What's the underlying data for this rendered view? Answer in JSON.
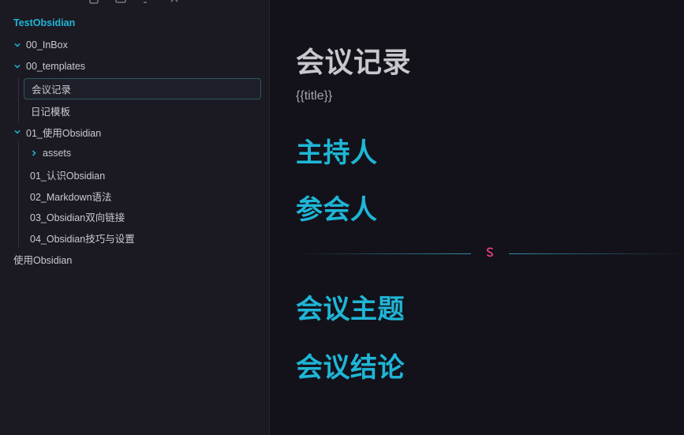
{
  "sidebar": {
    "toolbar_icons": [
      "new-note-icon",
      "new-folder-icon",
      "sort-icon",
      "collapse-icon"
    ],
    "vault_name": "TestObsidian",
    "tree": [
      {
        "label": "00_InBox",
        "type": "folder",
        "expanded": true
      },
      {
        "label": "00_templates",
        "type": "folder",
        "expanded": true
      },
      {
        "label": "会议记录",
        "type": "file",
        "active": true
      },
      {
        "label": "日记模板",
        "type": "file"
      },
      {
        "label": "01_使用Obsidian",
        "type": "folder",
        "expanded": true
      },
      {
        "label": "assets",
        "type": "folder",
        "expanded": false
      },
      {
        "label": "01_认识Obsidian",
        "type": "file"
      },
      {
        "label": "02_Markdown语法",
        "type": "file"
      },
      {
        "label": "03_Obsidian双向链接",
        "type": "file"
      },
      {
        "label": "04_Obsidian技巧与设置",
        "type": "file"
      },
      {
        "label": "使用Obsidian",
        "type": "file"
      }
    ]
  },
  "editor": {
    "h1": "会议记录",
    "body_text": "{{title}}",
    "sections": [
      {
        "label": "主持人"
      },
      {
        "label": "参会人"
      },
      {
        "label": "会议主题"
      },
      {
        "label": "会议结论"
      }
    ],
    "divider_icon": "section-divider-icon"
  },
  "colors": {
    "accent": "#1fb6d6",
    "sidebar_bg": "#1b1a23",
    "editor_bg": "#13121a",
    "text": "#c9c9cf",
    "divider_glyph": "#e0407a"
  }
}
